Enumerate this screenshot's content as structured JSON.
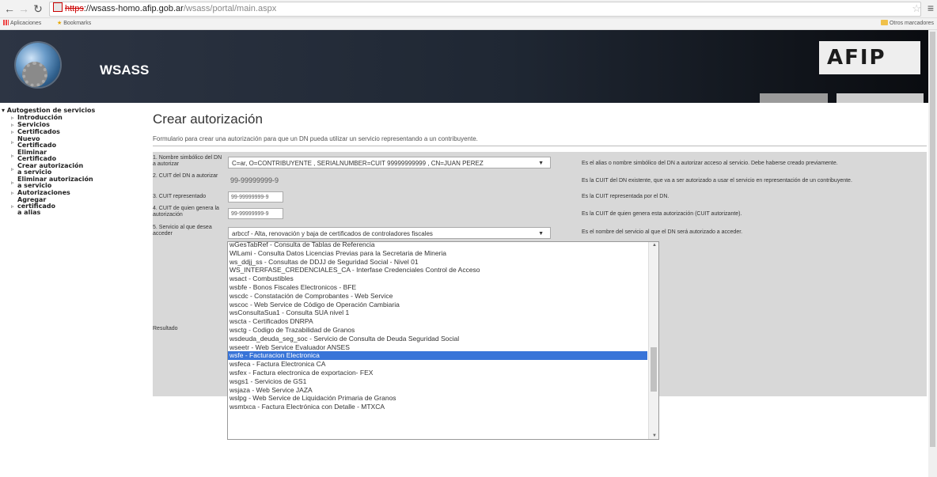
{
  "browser": {
    "url_proto": "https",
    "url_host": "://wsass-homo.afip.gob.ar",
    "url_path": "/wsass/portal/main.aspx",
    "bookmarks_apps": "Aplicaciones",
    "bookmarks_label": "Bookmarks",
    "other_bookmarks": "Otros marcadores"
  },
  "header": {
    "brand": "WSASS",
    "logo_text": "AFIP",
    "tab1": "",
    "tab2": ""
  },
  "sidebar": {
    "top": "▾ Autogestion de servicios",
    "items": [
      "Introducción",
      "Servicios",
      "Certificados",
      "Nuevo\nCertificado",
      "Eliminar\nCertificado",
      "Crear autorización\na servicio",
      "Eliminar autorización\na servicio",
      "Autorizaciones",
      "Agregar\ncertificado\na alias"
    ]
  },
  "main": {
    "title": "Crear autorización",
    "subtitle": "Formulario para crear una autorización para que un DN pueda utilizar un servicio representando a un contribuyente.",
    "rows": [
      {
        "label": "1. Nombre simbólico del DN a autorizar",
        "value": "C=ar, O=CONTRIBUYENTE , SERIALNUMBER=CUIT 99999999999 , CN=JUAN PEREZ",
        "help": "Es el alias o nombre simbólico del DN a autorizar acceso al servicio. Debe haberse creado previamente."
      },
      {
        "label": "2. CUIT del DN a autorizar",
        "value": "99-99999999-9",
        "help": "Es la CUIT del DN existente, que va a ser autorizado a usar el servicio en representación de un contribuyente."
      },
      {
        "label": "3. CUIT representado",
        "value": "99-99999999-9",
        "help": "Es la CUIT representada por el DN."
      },
      {
        "label": "4. CUIT de quien genera la autorización",
        "value": "99-99999999-9",
        "help": "Es la CUIT de quien genera esta autorización (CUIT autorizante)."
      },
      {
        "label": "5. Servicio al que desea acceder",
        "value": "arbccf - Alta, renovación y baja de certificados de controladores fiscales",
        "help": "Es el nombre del servicio al que el DN será autorizado a acceder."
      }
    ],
    "result_label": "Resultado"
  },
  "dropdown": {
    "options": [
      "wGesTabRef - Consulta de Tablas de Referencia",
      "WlLami - Consulta Datos Licencias Previas para la Secretaria de Mineria",
      "ws_ddjj_ss - Consultas de DDJJ de Seguridad Social - Nivel 01",
      "WS_INTERFASE_CREDENCIALES_CA - Interfase Credenciales Control de Acceso",
      "wsact - Combustibles",
      "wsbfe - Bonos Fiscales Electronicos - BFE",
      "wscdc - Constatación de Comprobantes - Web Service",
      "wscoc - Web Service de Código de Operación Cambiaria",
      "wsConsultaSua1 - Consulta SUA nivel 1",
      "wscta - Certificados DNRPA",
      "wsctg - Codigo de Trazabilidad de Granos",
      "wsdeuda_deuda_seg_soc - Servicio de Consulta de Deuda Seguridad Social",
      "wseetr - Web Service Evaluador ANSES",
      "wsfe - Facturacion Electronica",
      "wsfeca - Factura Electronica CA",
      "wsfex - Factura electronica de exportacion- FEX",
      "wsgs1 - Servicios de GS1",
      "wsjaza - Web Service JAZA",
      "wslpg - Web Service de Liquidación Primaria de Granos",
      "wsmtxca - Factura Electrónica con Detalle - MTXCA"
    ],
    "highlighted_index": 13
  }
}
